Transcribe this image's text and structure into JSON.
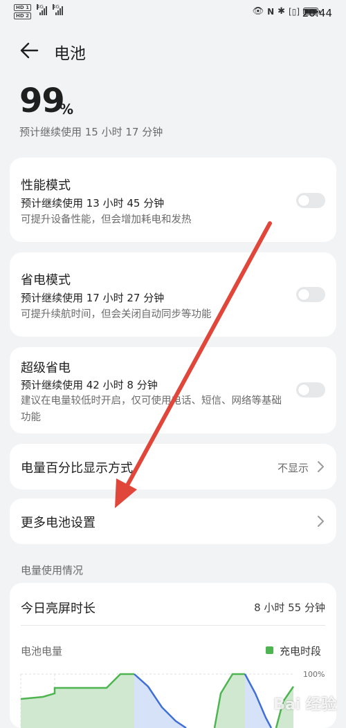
{
  "status_bar": {
    "hd1": "HD 1",
    "hd2": "HD 2",
    "net1": "4G",
    "net2": "4G",
    "time": "20:44"
  },
  "header": {
    "title": "电池"
  },
  "battery": {
    "percent": "99",
    "percent_sign": "%",
    "level_fraction": 0.99,
    "estimate": "预计继续使用 15 小时 17 分钟"
  },
  "modes": [
    {
      "title": "性能模式",
      "subtitle": "预计继续使用 13 小时 45 分钟",
      "desc": "可提升设备性能，但会增加耗电和发热",
      "enabled": false
    },
    {
      "title": "省电模式",
      "subtitle": "预计继续使用 17 小时 27 分钟",
      "desc": "可提升续航时间，但会关闭自动同步等功能",
      "enabled": false
    },
    {
      "title": "超级省电",
      "subtitle": "预计继续使用 42 小时 8 分钟",
      "desc": "建议在电量较低时开启，仅可使用电话、短信、网络等基础功能",
      "enabled": false
    }
  ],
  "percent_display": {
    "label": "电量百分比显示方式",
    "value": "不显示"
  },
  "more_settings": {
    "label": "更多电池设置"
  },
  "usage": {
    "section_title": "电量使用情况",
    "screen_time_label": "今日亮屏时长",
    "screen_time_value": "8 小时 55 分钟",
    "battery_label": "电池电量",
    "legend_label": "充电时段",
    "axis_top": "100%"
  },
  "colors": {
    "charge_green": "#4cb54f",
    "discharge_blue": "#3f6fd6",
    "annotation_arrow": "#e0473a"
  },
  "watermark": "Bai 经验"
}
